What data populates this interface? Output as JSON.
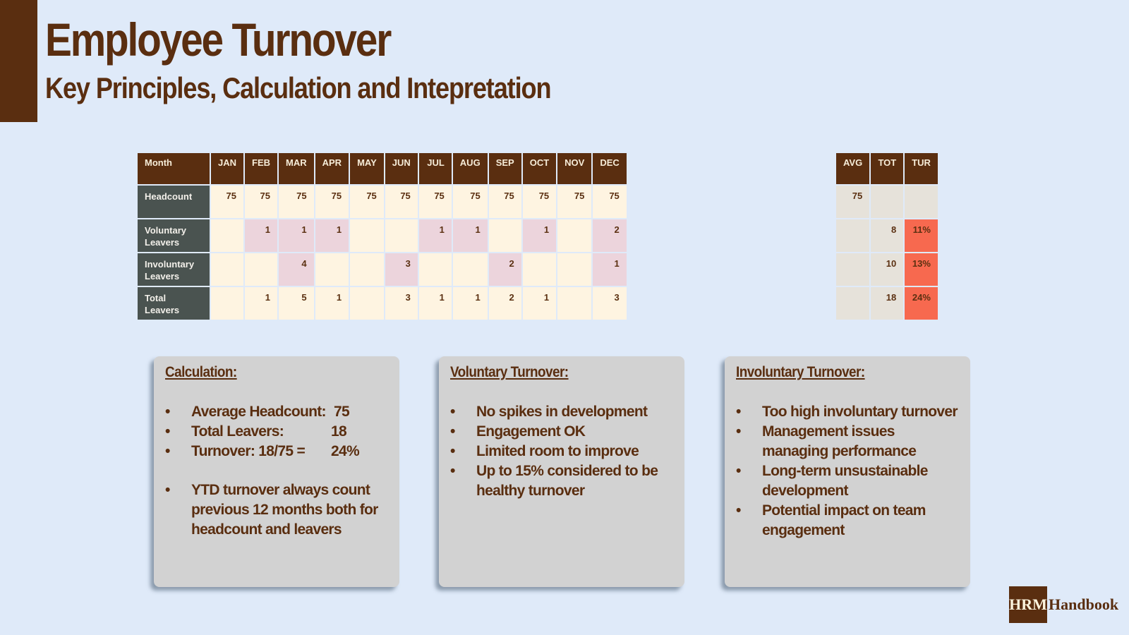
{
  "header": {
    "title": "Employee Turnover",
    "subtitle": "Key Principles, Calculation and Intepretation"
  },
  "table": {
    "month_header": "Month",
    "months": [
      "JAN",
      "FEB",
      "MAR",
      "APR",
      "MAY",
      "JUN",
      "JUL",
      "AUG",
      "SEP",
      "OCT",
      "NOV",
      "DEC"
    ],
    "rows": [
      {
        "label": "Headcount",
        "values": [
          "75",
          "75",
          "75",
          "75",
          "75",
          "75",
          "75",
          "75",
          "75",
          "75",
          "75",
          "75"
        ],
        "highlight": [
          false,
          false,
          false,
          false,
          false,
          false,
          false,
          false,
          false,
          false,
          false,
          false
        ]
      },
      {
        "label": "Voluntary Leavers",
        "values": [
          "",
          "1",
          "1",
          "1",
          "",
          "",
          "1",
          "1",
          "",
          "1",
          "",
          "2"
        ],
        "highlight": [
          false,
          true,
          true,
          true,
          false,
          false,
          true,
          true,
          false,
          true,
          false,
          true
        ]
      },
      {
        "label": "Involuntary Leavers",
        "values": [
          "",
          "",
          "4",
          "",
          "",
          "3",
          "",
          "",
          "2",
          "",
          "",
          "1"
        ],
        "highlight": [
          false,
          false,
          true,
          false,
          false,
          true,
          false,
          false,
          true,
          false,
          false,
          true
        ]
      },
      {
        "label": "Total Leavers",
        "values": [
          "",
          "1",
          "5",
          "1",
          "",
          "3",
          "1",
          "1",
          "2",
          "1",
          "",
          "3"
        ],
        "highlight": [
          false,
          false,
          false,
          false,
          false,
          false,
          false,
          false,
          false,
          false,
          false,
          false
        ]
      }
    ]
  },
  "summary": {
    "headers": [
      "AVG",
      "TOT",
      "TUR"
    ],
    "rows": [
      {
        "avg": "75",
        "tot": "",
        "tur": ""
      },
      {
        "avg": "",
        "tot": "8",
        "tur": "11%"
      },
      {
        "avg": "",
        "tot": "10",
        "tur": "13%"
      },
      {
        "avg": "",
        "tot": "18",
        "tur": "24%"
      }
    ]
  },
  "colors": {
    "brand_brown": "#5a2e10",
    "label_slate": "#4a5350",
    "cell_cream": "#fef4e1",
    "cell_pink": "#ecd4dc",
    "summary_grey": "#e6e2da",
    "turnover_red": "#f7694f",
    "background": "#dfeaf9"
  },
  "cards": {
    "calculation": {
      "title": "Calculation:",
      "items": [
        {
          "text": "Average Headcount:",
          "value": "75"
        },
        {
          "text": "Total Leavers:",
          "value": "18"
        },
        {
          "text": "Turnover: 18/75 =",
          "value": "24%"
        },
        {
          "text": "YTD turnover always count previous 12 months both for headcount and leavers",
          "value": ""
        }
      ]
    },
    "voluntary": {
      "title": "Voluntary Turnover:",
      "items": [
        "No spikes in development",
        "Engagement OK",
        "Limited room to improve",
        "Up to 15% considered to be healthy turnover"
      ]
    },
    "involuntary": {
      "title": "Involuntary Turnover:",
      "items": [
        "Too high involuntary turnover",
        "Management issues managing performance",
        "Long-term unsustainable development",
        "Potential impact on team engagement"
      ]
    }
  },
  "logo": {
    "box_text": "HRM",
    "text": "Handbook"
  },
  "bullet_glyph": "•"
}
